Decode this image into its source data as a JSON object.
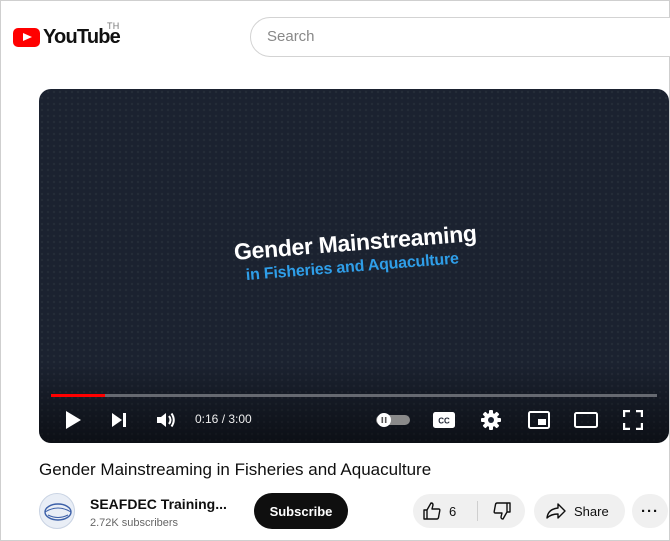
{
  "header": {
    "logo_text": "YouTube",
    "country_code": "TH",
    "search_placeholder": "Search"
  },
  "player": {
    "title_card_line1": "Gender Mainstreaming",
    "title_card_line2": "in Fisheries and Aquaculture",
    "time_display": "0:16 / 3:00",
    "progress_fraction": 0.089,
    "progress_color": "#ff0000",
    "background_color": "#1b2230",
    "subtitle_accent_color": "#2f9ee8"
  },
  "video": {
    "title": "Gender Mainstreaming in Fisheries and Aquaculture"
  },
  "channel": {
    "name": "SEAFDEC Training...",
    "subscribers": "2.72K subscribers",
    "subscribe_label": "Subscribe"
  },
  "actions": {
    "like_count": "6",
    "share_label": "Share",
    "more_label": "···"
  },
  "icons": [
    "youtube-logo-icon",
    "play-icon",
    "next-icon",
    "volume-icon",
    "autoplay-toggle-icon",
    "captions-icon",
    "settings-icon",
    "miniplayer-icon",
    "theater-icon",
    "fullscreen-icon",
    "like-icon",
    "dislike-icon",
    "share-icon",
    "more-icon"
  ]
}
